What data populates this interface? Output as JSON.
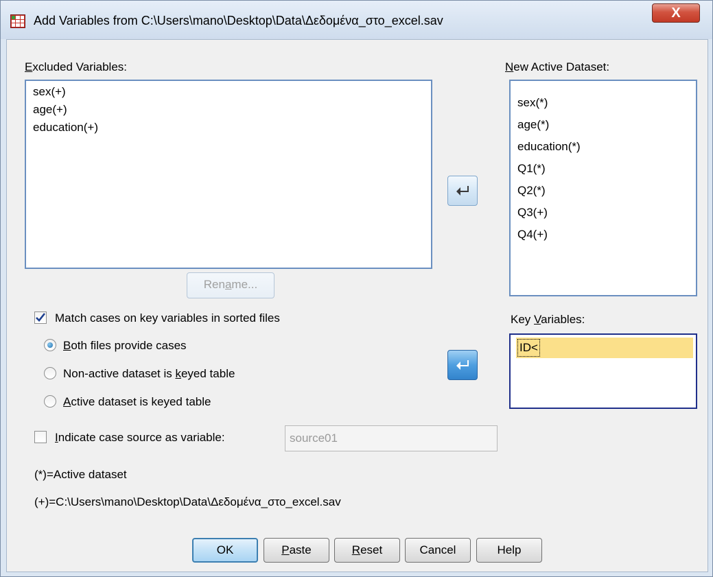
{
  "window": {
    "title": "Add Variables from C:\\Users\\mano\\Desktop\\Data\\Δεδομένα_στο_excel.sav",
    "close_label": "X"
  },
  "excluded": {
    "label_pre": "",
    "label_u": "E",
    "label_post": "xcluded Variables:",
    "items": [
      "sex(+)",
      "age(+)",
      "education(+)"
    ]
  },
  "new_active": {
    "label_pre": "",
    "label_u": "N",
    "label_post": "ew Active Dataset:",
    "items": [
      "sex(*)",
      "age(*)",
      "education(*)",
      "Q1(*)",
      "Q2(*)",
      "Q3(+)",
      "Q4(+)"
    ]
  },
  "rename": {
    "pre": "Ren",
    "u": "a",
    "post": "me..."
  },
  "match_cases": {
    "label": "Match cases on key variables in sorted files",
    "checked": true
  },
  "radios": [
    {
      "pre": "",
      "u": "B",
      "post": "oth files provide cases",
      "selected": true
    },
    {
      "pre": "Non-active dataset is ",
      "u": "k",
      "post": "eyed table",
      "selected": false
    },
    {
      "pre": "",
      "u": "A",
      "post": "ctive dataset is keyed table",
      "selected": false
    }
  ],
  "key_variables": {
    "label_pre": "Key ",
    "label_u": "V",
    "label_post": "ariables:",
    "items": [
      "ID<"
    ]
  },
  "indicate": {
    "pre": "",
    "u": "I",
    "post": "ndicate case source as variable:",
    "checked": false,
    "value": "source01"
  },
  "notes": {
    "active": "(*)=Active dataset",
    "nonactive": "(+)=C:\\Users\\mano\\Desktop\\Data\\Δεδομένα_στο_excel.sav"
  },
  "buttons": [
    {
      "pre": "OK",
      "u": "",
      "post": ""
    },
    {
      "pre": "",
      "u": "P",
      "post": "aste"
    },
    {
      "pre": "",
      "u": "R",
      "post": "eset"
    },
    {
      "pre": "Cancel",
      "u": "",
      "post": ""
    },
    {
      "pre": "Help",
      "u": "",
      "post": ""
    }
  ],
  "colors": {
    "selection_highlight": "#fbe08a",
    "focus_border": "#1f2f8a",
    "arrow_icon": "#3a3a3a",
    "arrow_icon_active": "#ffffff"
  },
  "icons": {
    "app": "spss-data-grid-icon",
    "arrows": "left-arrow-icon"
  }
}
